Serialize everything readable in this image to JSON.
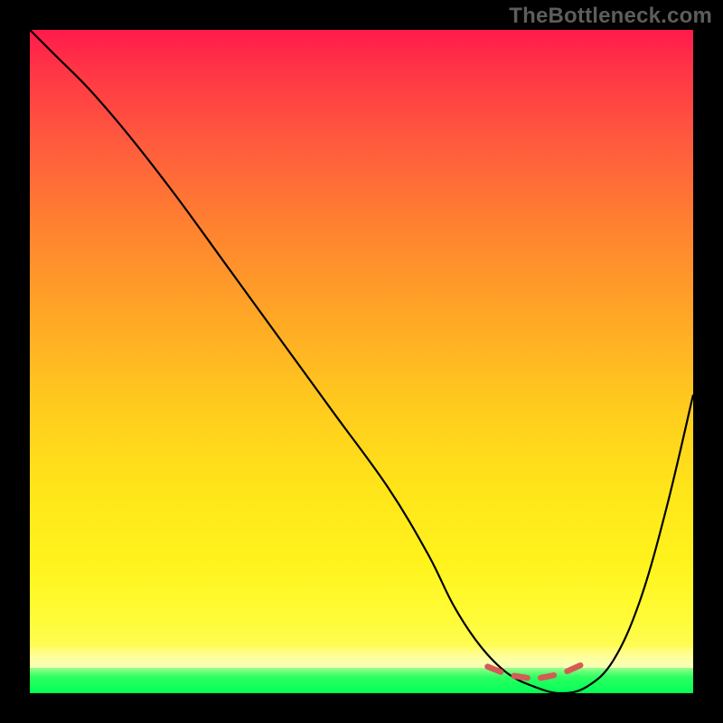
{
  "watermark": "TheBottleneck.com",
  "colors": {
    "background": "#000000",
    "watermark_text": "#5d5d5d",
    "curve": "#000000",
    "bumps": "#d65a55",
    "gradient_top": "#ff1a4b",
    "gradient_mid": "#ffe41a",
    "gradient_green": "#00ff55"
  },
  "chart_data": {
    "type": "line",
    "title": "",
    "xlabel": "",
    "ylabel": "",
    "xlim": [
      0,
      100
    ],
    "ylim": [
      0,
      100
    ],
    "grid": false,
    "legend": false,
    "series": [
      {
        "name": "bottleneck-curve",
        "x": [
          0,
          4,
          9,
          15,
          22,
          30,
          38,
          46,
          54,
          60,
          64,
          68,
          72,
          76,
          80,
          84,
          88,
          92,
          96,
          100
        ],
        "y": [
          100,
          96,
          91,
          84,
          75,
          64,
          53,
          42,
          31,
          21,
          13,
          7,
          3,
          1,
          0,
          1,
          5,
          14,
          28,
          45
        ]
      },
      {
        "name": "highlight-valley",
        "x": [
          69,
          71,
          73,
          75,
          77,
          79,
          81,
          83
        ],
        "y": [
          4.0,
          3.2,
          2.6,
          2.3,
          2.3,
          2.7,
          3.3,
          4.2
        ]
      }
    ],
    "annotations": [
      {
        "text": "TheBottleneck.com",
        "position": "top-right"
      }
    ]
  }
}
